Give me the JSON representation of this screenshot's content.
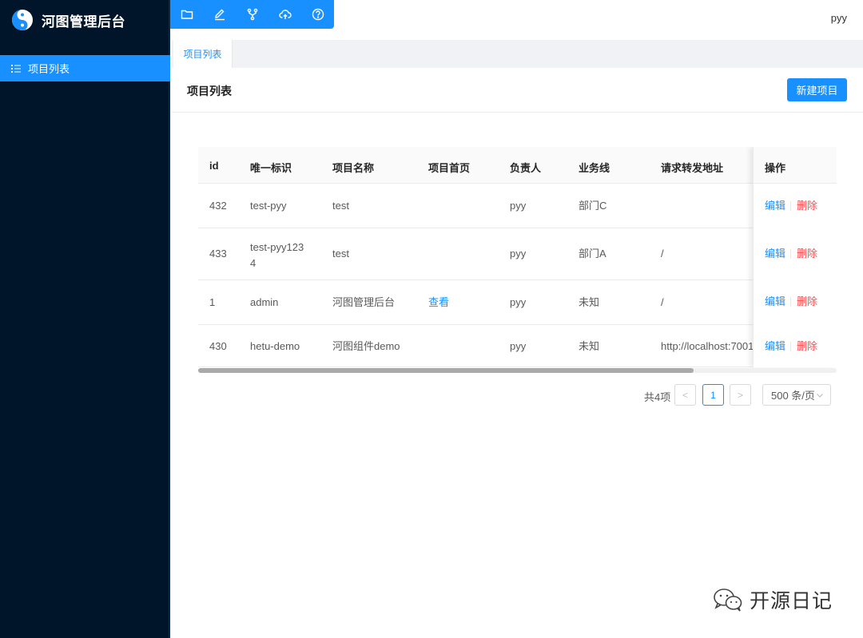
{
  "app": {
    "title": "河图管理后台",
    "logo_icon": "yin-yang-logo-icon"
  },
  "sidebar": {
    "items": [
      {
        "label": "项目列表",
        "icon": "list-icon",
        "active": true
      }
    ]
  },
  "toolbar": {
    "icons": [
      "folder-icon",
      "edit-icon",
      "branch-icon",
      "cloud-upload-icon",
      "help-icon"
    ]
  },
  "user": {
    "name": "pyy"
  },
  "tabs": [
    {
      "label": "项目列表",
      "active": true
    }
  ],
  "page": {
    "title": "项目列表",
    "new_button": "新建项目"
  },
  "table": {
    "columns": [
      "id",
      "唯一标识",
      "项目名称",
      "项目首页",
      "负责人",
      "业务线",
      "请求转发地址",
      "操作"
    ],
    "rows": [
      {
        "id": "432",
        "key": "test-pyy",
        "name": "test",
        "home": "",
        "owner": "pyy",
        "line": "部门C",
        "proxy": "",
        "edit": "编辑",
        "delete": "删除"
      },
      {
        "id": "433",
        "key": "test-pyy1234",
        "name": "test",
        "home": "",
        "owner": "pyy",
        "line": "部门A",
        "proxy": "/",
        "edit": "编辑",
        "delete": "删除"
      },
      {
        "id": "1",
        "key": "admin",
        "name": "河图管理后台",
        "home": "查看",
        "owner": "pyy",
        "line": "未知",
        "proxy": "/",
        "edit": "编辑",
        "delete": "删除"
      },
      {
        "id": "430",
        "key": "hetu-demo",
        "name": "河图组件demo",
        "home": "",
        "owner": "pyy",
        "line": "未知",
        "proxy": "http://localhost:7001",
        "edit": "编辑",
        "delete": "删除"
      }
    ]
  },
  "pagination": {
    "total": "共4项",
    "prev": "<",
    "current": "1",
    "next": ">",
    "page_size": "500 条/页"
  },
  "watermark": {
    "text": "开源日记"
  },
  "colors": {
    "primary": "#1890ff",
    "sidebar_bg": "#001529",
    "danger": "#ff4d4f"
  }
}
